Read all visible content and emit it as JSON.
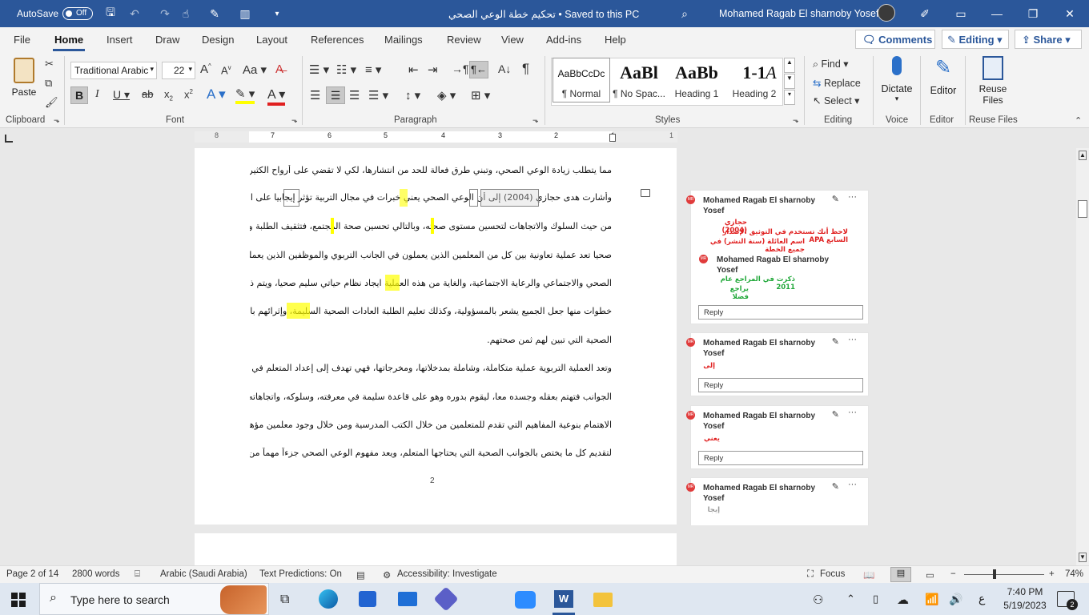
{
  "titlebar": {
    "autosave_label": "AutoSave",
    "autosave_state": "Off",
    "doc_title": "تحكيم خطة الوعي الصحي  •  Saved to this PC",
    "user_name": "Mohamed Ragab El sharnoby Yosef"
  },
  "menu": {
    "tabs": [
      "File",
      "Home",
      "Insert",
      "Draw",
      "Design",
      "Layout",
      "References",
      "Mailings",
      "Review",
      "View",
      "Add-ins",
      "Help"
    ],
    "active": "Home",
    "comments_label": "Comments",
    "editing_label": "Editing",
    "share_label": "Share"
  },
  "ribbon": {
    "paste_label": "Paste",
    "font_name": "Traditional Arabic",
    "font_size": "22",
    "styles": [
      {
        "sample": "AaBbCcDc",
        "label": "¶ Normal"
      },
      {
        "sample": "AaBl",
        "label": "¶ No Spac..."
      },
      {
        "sample": "AaBb",
        "label": "Heading 1"
      },
      {
        "sample": "1-1",
        "label": "Heading 2"
      },
      {
        "sample": "A",
        "label": ""
      }
    ],
    "find_label": "Find",
    "replace_label": "Replace",
    "select_label": "Select",
    "dictate_label": "Dictate",
    "editor_label": "Editor",
    "reuse_label": "Reuse Files",
    "groups": {
      "clipboard": "Clipboard",
      "font": "Font",
      "paragraph": "Paragraph",
      "styles": "Styles",
      "editing": "Editing",
      "voice": "Voice",
      "editor": "Editor",
      "reuse": "Reuse Files"
    }
  },
  "ruler_numbers": [
    "8",
    "7",
    "6",
    "5",
    "4",
    "3",
    "2",
    "1",
    "1"
  ],
  "document": {
    "lines": [
      "مما يتطلب زيادة الوعي الصحي، وتبني طرق فعالة للحد من انتشارها، لكي لا تقضي على أرواح الكثير من أفرادها.",
      "وأشارت هدى حجازي (2004) إلى أن الوعي الصحي يعني خبرات في مجال التربية تؤثر إيجابيا على الفرد",
      "من حيث السلوك والاتجاهات لتحسين مستوى صحته، وبالتالي تحسين صحة المجتمع، فتثقيف الطلبة وتوعيتهم",
      "صحيا تعد عملية تعاونية بين كل من المعلمين الذين يعملون في الجانب التربوي والموظفين الذين يعملون في الجانب",
      "الصحي والاجتماعي والرعاية الاجتماعية، والغاية من هذه العملية ايجاد نظام حياتي سليم صحيا، ويتم ذلك بعدة",
      "خطوات منها جعل الجميع يشعر بالمسؤولية، وكذلك تعليم الطلبة العادات الصحية السليمة، وإثرائهم بالمعلومات",
      "الصحية التي تبين لهم ثمن صحتهم.",
      "وتعد العملية التربوية عملية متكاملة، وشاملة بمدخلاتها، ومخرجاتها، فهي تهدف إلى إعداد المتعلم في جميع",
      "الجوانب فتهتم بعقله وجسده معا، ليقوم بدوره وهو على قاعدة سليمة في معرفته، وسلوكه، واتجاهاته، ومن ثم كان",
      "الاهتمام بنوعية المفاهيم التي تقدم للمتعلمين من خلال الكتب المدرسية ومن خلال وجود معلمين مؤهلين ومدربين",
      "لتقديم كل ما يختص بالجوانب الصحية التي يحتاجها المتعلم، ويعد مفهوم الوعي الصحي جزءاً مهماً من العملية التربوية"
    ],
    "page_number": "2"
  },
  "comments": [
    {
      "author": "Mohamed Ragab El sharnoby Yosef",
      "text_lines": [
        "حجازي (2004)",
        "لاحظ أنك تستخدم في التوثيق الإصدار السابع APA",
        "اسم العائلة (سنة النشر) في جميع الخطة"
      ],
      "text_color": "#e02020",
      "reply": {
        "author": "Mohamed Ragab El sharnoby Yosef",
        "text_lines": [
          "ذكرت في المراجع عام 2011",
          "يراجع فضلا"
        ],
        "text_color": "#21a83a"
      },
      "reply_placeholder": "Reply"
    },
    {
      "author": "Mohamed Ragab El sharnoby Yosef",
      "text_lines": [
        "إلى"
      ],
      "text_color": "#e02020",
      "reply_placeholder": "Reply"
    },
    {
      "author": "Mohamed Ragab El sharnoby Yosef",
      "text_lines": [
        "يعني"
      ],
      "text_color": "#e02020",
      "reply_placeholder": "Reply"
    },
    {
      "author": "Mohamed Ragab El sharnoby Yosef",
      "text_lines": [
        "إيجا"
      ],
      "text_color": "#999999",
      "reply_placeholder": ""
    }
  ],
  "status": {
    "page": "Page 2 of 14",
    "words": "2800 words",
    "language": "Arabic (Saudi Arabia)",
    "predictions": "Text Predictions: On",
    "accessibility": "Accessibility: Investigate",
    "focus": "Focus",
    "zoom": "74%"
  },
  "taskbar": {
    "search_placeholder": "Type here to search",
    "time": "7:40 PM",
    "date": "5/19/2023",
    "notification_count": "2",
    "lang_indicator": "ع"
  },
  "colors": {
    "titlebar": "#2b579a",
    "accent": "#2b579a",
    "highlight": "#ffff00"
  }
}
